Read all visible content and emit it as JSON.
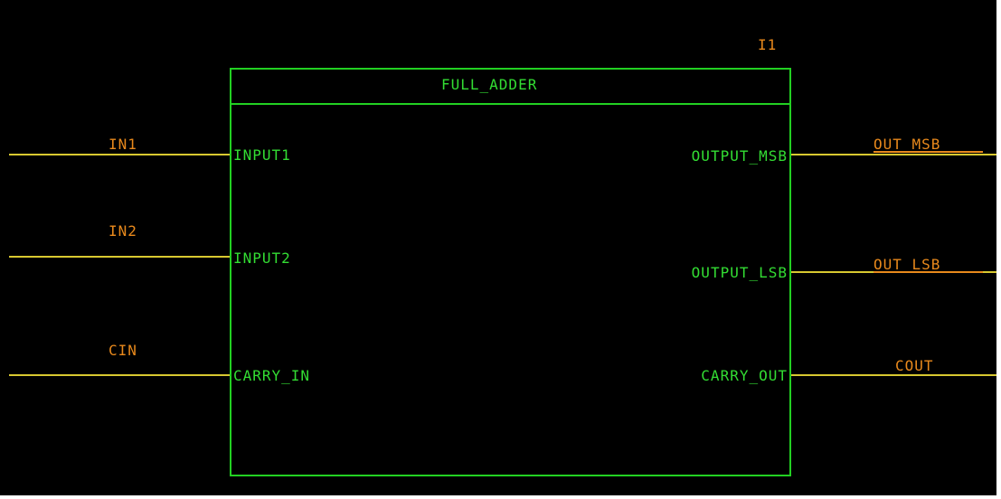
{
  "instance_name": "I1",
  "block_title": "FULL_ADDER",
  "ports_left": [
    {
      "port": "INPUT1",
      "net": "IN1"
    },
    {
      "port": "INPUT2",
      "net": "IN2"
    },
    {
      "port": "CARRY_IN",
      "net": "CIN"
    }
  ],
  "ports_right": [
    {
      "port": "OUTPUT_MSB",
      "net": "OUT_MSB"
    },
    {
      "port": "OUTPUT_LSB",
      "net": "OUT_LSB"
    },
    {
      "port": "CARRY_OUT",
      "net": "COUT"
    }
  ],
  "colors": {
    "background": "#000000",
    "symbol": "#22d022",
    "net_label": "#e8891c",
    "wire": "#d8c830"
  }
}
